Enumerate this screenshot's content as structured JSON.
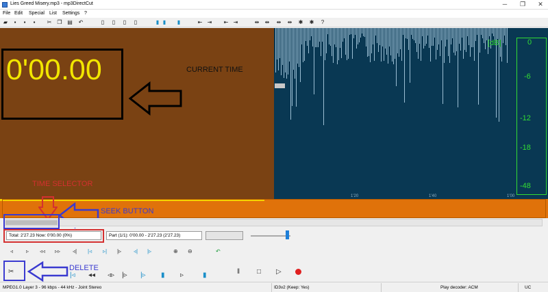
{
  "window": {
    "title": "Lies Greed Misery.mp3 - mp3DirectCut",
    "minimize": "─",
    "maximize": "❐",
    "close": "✕"
  },
  "menu": [
    "File",
    "Edit",
    "Special",
    "List",
    "Settings",
    "?"
  ],
  "display": {
    "current_time": "0'00.00",
    "db_unit": "[dB]",
    "db_scale": [
      "0",
      "-6",
      "-12",
      "-18",
      "-48"
    ],
    "time_marks": [
      "1'20",
      "1'40",
      "1'00"
    ]
  },
  "info_fields": {
    "total_now": "Total: 2'27.23   Now: 0'00.00   (0%)",
    "part": "Part (1/1): 0'00.00 - 2'27.23 (2'27.23)"
  },
  "status": {
    "format": "MPEG1.0 Layer 3 - 96 kbps - 44 kHz - Joint Stereo",
    "id3": "ID3v2 (Keep: Yes)",
    "decoder": "Play decoder: ACM",
    "mode": "UC"
  },
  "annotations": {
    "current_time": "CURRENT TIME",
    "time_selector": "TIME SELECTOR",
    "seek_button": "SEEK BUTTON",
    "delete": "DELETE"
  },
  "playback_position": 0.0,
  "colors": {
    "time_bg": "#7a4213",
    "time_digits": "#f2e600",
    "wave_bg": "#093853",
    "db_green": "#33dd33",
    "orange_bar": "#e0720a",
    "annot_blue": "#3a3ad0",
    "annot_red": "#d43030"
  }
}
